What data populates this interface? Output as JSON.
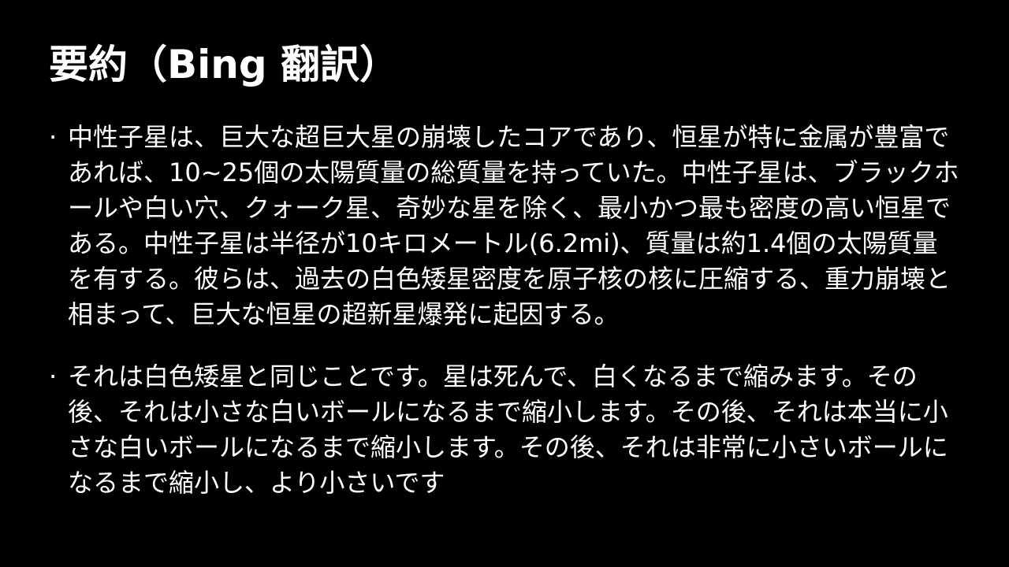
{
  "slide": {
    "title": "要約（Bing 翻訳）",
    "bullets": [
      {
        "mark": "·",
        "text": "中性子星は、巨大な超巨大星の崩壊したコアであり、恒星が特に金属が豊富であれば、10~25個の太陽質量の総質量を持っていた。中性子星は、ブラックホールや白い穴、クォーク星、奇妙な星を除く、最小かつ最も密度の高い恒星である。中性子星は半径が10キロメートル(6.2mi)、質量は約1.4個の太陽質量を有する。彼らは、過去の白色矮星密度を原子核の核に圧縮する、重力崩壊と相まって、巨大な恒星の超新星爆発に起因する。"
      },
      {
        "mark": "·",
        "text": "それは白色矮星と同じことです。星は死んで、白くなるまで縮みます。その後、それは小さな白いボールになるまで縮小します。その後、それは本当に小さな白いボールになるまで縮小します。その後、それは非常に小さいボールになるまで縮小し、より小さいです"
      }
    ]
  }
}
